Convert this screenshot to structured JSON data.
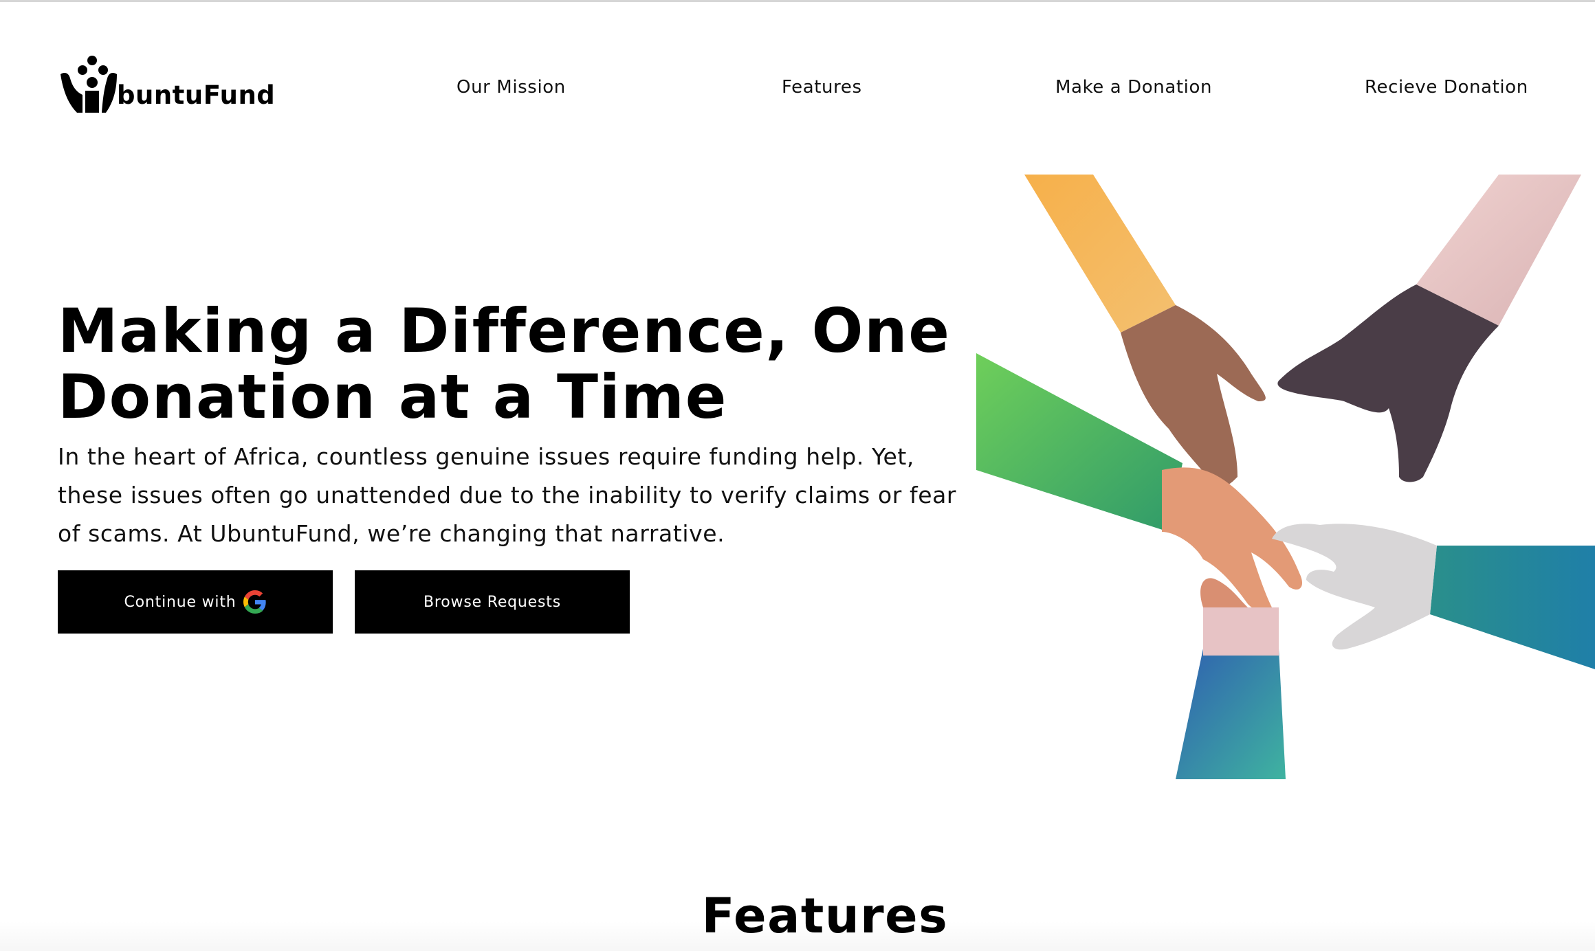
{
  "brand": {
    "name": "buntuFund"
  },
  "nav": {
    "items": [
      {
        "label": "Our Mission"
      },
      {
        "label": "Features"
      },
      {
        "label": "Make a Donation"
      },
      {
        "label": "Recieve Donation"
      }
    ]
  },
  "hero": {
    "title_line1": "Making a Difference, One",
    "title_line2": "Donation at a Time",
    "description": "In the heart of Africa, countless genuine issues require funding help. Yet, these issues often go unattended due to the inability to verify claims or fear of scams. At UbuntuFund, we’re changing that narrative.",
    "primary_button": "Continue with",
    "secondary_button": "Browse Requests",
    "illustration_icon": "hands-heart-illustration"
  },
  "features": {
    "title": "Features"
  },
  "colors": {
    "background": "#ffffff",
    "text": "#000000",
    "button_bg": "#000000",
    "button_text": "#ffffff",
    "google_blue": "#4285F4",
    "google_red": "#EA4335",
    "google_yellow": "#FBBC05",
    "google_green": "#34A853"
  }
}
